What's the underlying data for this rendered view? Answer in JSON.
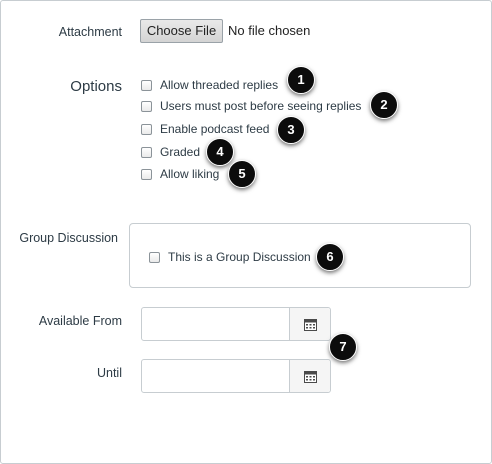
{
  "attachment": {
    "label": "Attachment",
    "button_label": "Choose File",
    "status": "No file chosen"
  },
  "options": {
    "label": "Options",
    "items": [
      {
        "label": "Allow threaded replies",
        "checked": false,
        "badge": "1"
      },
      {
        "label": "Users must post before seeing replies",
        "checked": false,
        "badge": "2"
      },
      {
        "label": "Enable podcast feed",
        "checked": false,
        "badge": "3"
      },
      {
        "label": "Graded",
        "checked": false,
        "badge": "4"
      },
      {
        "label": "Allow liking",
        "checked": false,
        "badge": "5"
      }
    ]
  },
  "group_discussion": {
    "label": "Group Discussion",
    "checkbox_label": "This is a Group Discussion",
    "checked": false,
    "badge": "6"
  },
  "available_from": {
    "label": "Available From",
    "value": ""
  },
  "until": {
    "label": "Until",
    "value": ""
  },
  "dates_badge": "7",
  "icons": {
    "calendar": "calendar-icon"
  }
}
